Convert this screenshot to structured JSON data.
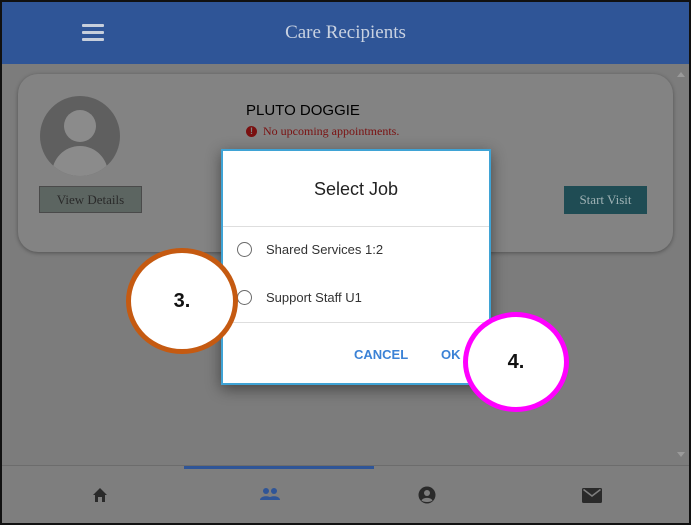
{
  "header": {
    "title": "Care Recipients",
    "menu_icon": "hamburger-menu-icon"
  },
  "card": {
    "recipient_name": "PLUTO DOGGIE",
    "appointment_status": "No upcoming appointments.",
    "status_icon": "error-circle-icon",
    "view_details_label": "View Details",
    "start_visit_label": "Start Visit",
    "avatar_icon": "user-avatar-icon"
  },
  "dialog": {
    "title": "Select Job",
    "options": [
      {
        "label": "Shared Services 1:2",
        "selected": false
      },
      {
        "label": "Support Staff U1",
        "selected": false
      }
    ],
    "cancel_label": "CANCEL",
    "ok_label": "OK"
  },
  "bottom_nav": {
    "items": [
      {
        "icon": "home-icon",
        "active": false
      },
      {
        "icon": "people-icon",
        "active": true
      },
      {
        "icon": "account-circle-icon",
        "active": false
      },
      {
        "icon": "mail-icon",
        "active": false
      }
    ]
  },
  "annotations": {
    "step_3": "3.",
    "step_4": "4."
  },
  "colors": {
    "header": "#2f5597",
    "start_visit": "#1f4c54",
    "dialog_border": "#3fa3d5",
    "dialog_button_text": "#3b82d6",
    "callout_3_ring": "#c55a11",
    "callout_4_ring": "#ff00ff",
    "overlay": "#7c7c7c"
  }
}
